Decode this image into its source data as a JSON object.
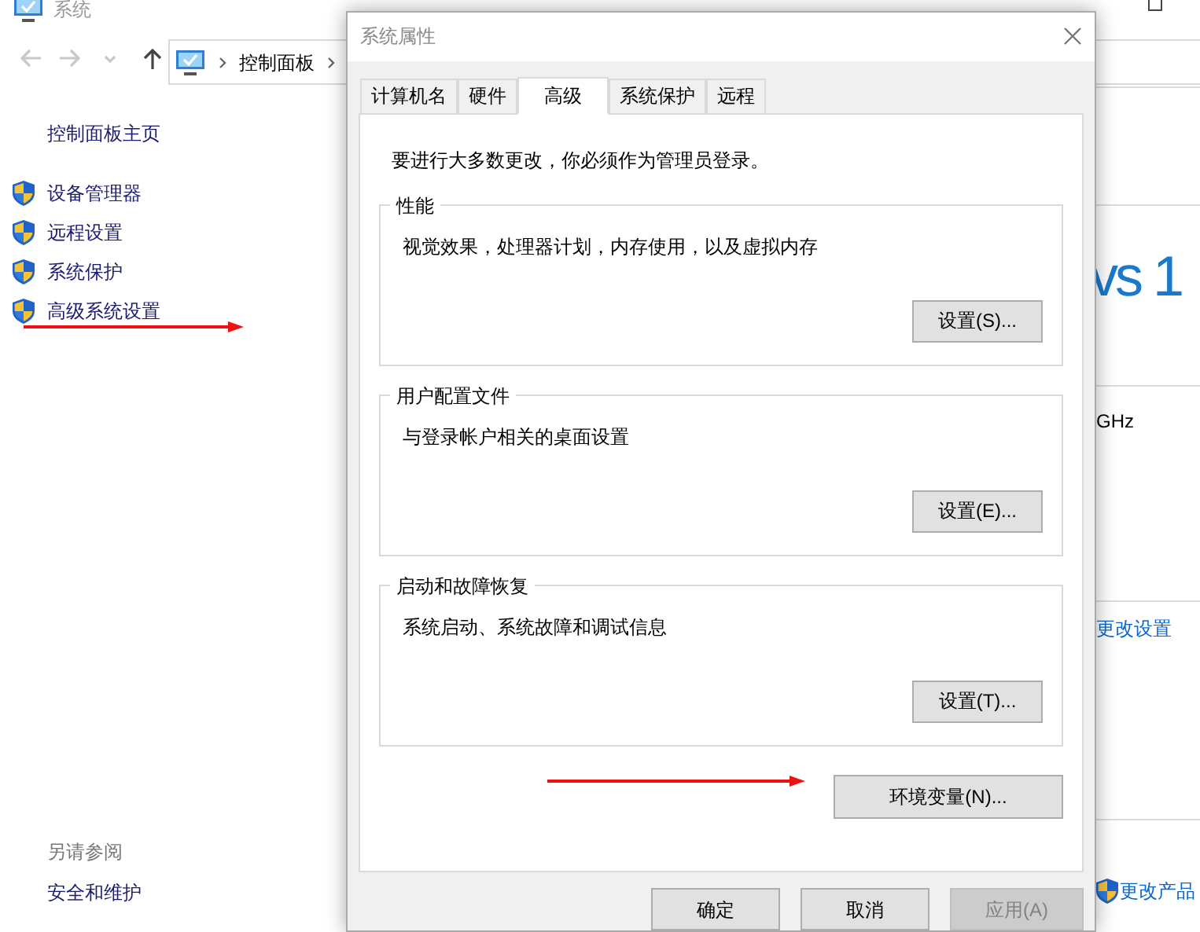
{
  "background_window": {
    "title": "系统",
    "breadcrumb": [
      "控制面板"
    ],
    "sidebar_home": "控制面板主页",
    "sidebar_items": [
      {
        "label": "设备管理器"
      },
      {
        "label": "远程设置"
      },
      {
        "label": "系统保护"
      },
      {
        "label": "高级系统设置"
      }
    ],
    "see_also_title": "另请参阅",
    "see_also_items": [
      "安全和维护"
    ],
    "logo_text": "vs 1",
    "cpu_text": "GHz",
    "change_settings_link": "更改设置",
    "product_key_link": "更改产品"
  },
  "dialog": {
    "title": "系统属性",
    "tabs": [
      {
        "label": "计算机名",
        "selected": false
      },
      {
        "label": "硬件",
        "selected": false
      },
      {
        "label": "高级",
        "selected": true
      },
      {
        "label": "系统保护",
        "selected": false
      },
      {
        "label": "远程",
        "selected": false
      }
    ],
    "notice": "要进行大多数更改，你必须作为管理员登录。",
    "groups": [
      {
        "title": "性能",
        "description": "视觉效果，处理器计划，内存使用，以及虚拟内存",
        "button": "设置(S)..."
      },
      {
        "title": "用户配置文件",
        "description": "与登录帐户相关的桌面设置",
        "button": "设置(E)..."
      },
      {
        "title": "启动和故障恢复",
        "description": "系统启动、系统故障和调试信息",
        "button": "设置(T)..."
      }
    ],
    "env_button": "环境变量(N)...",
    "footer_buttons": [
      {
        "label": "确定",
        "disabled": false
      },
      {
        "label": "取消",
        "disabled": false
      },
      {
        "label": "应用(A)",
        "disabled": true
      }
    ]
  },
  "annotations": [
    {
      "kind": "arrow"
    },
    {
      "kind": "arrow"
    }
  ]
}
